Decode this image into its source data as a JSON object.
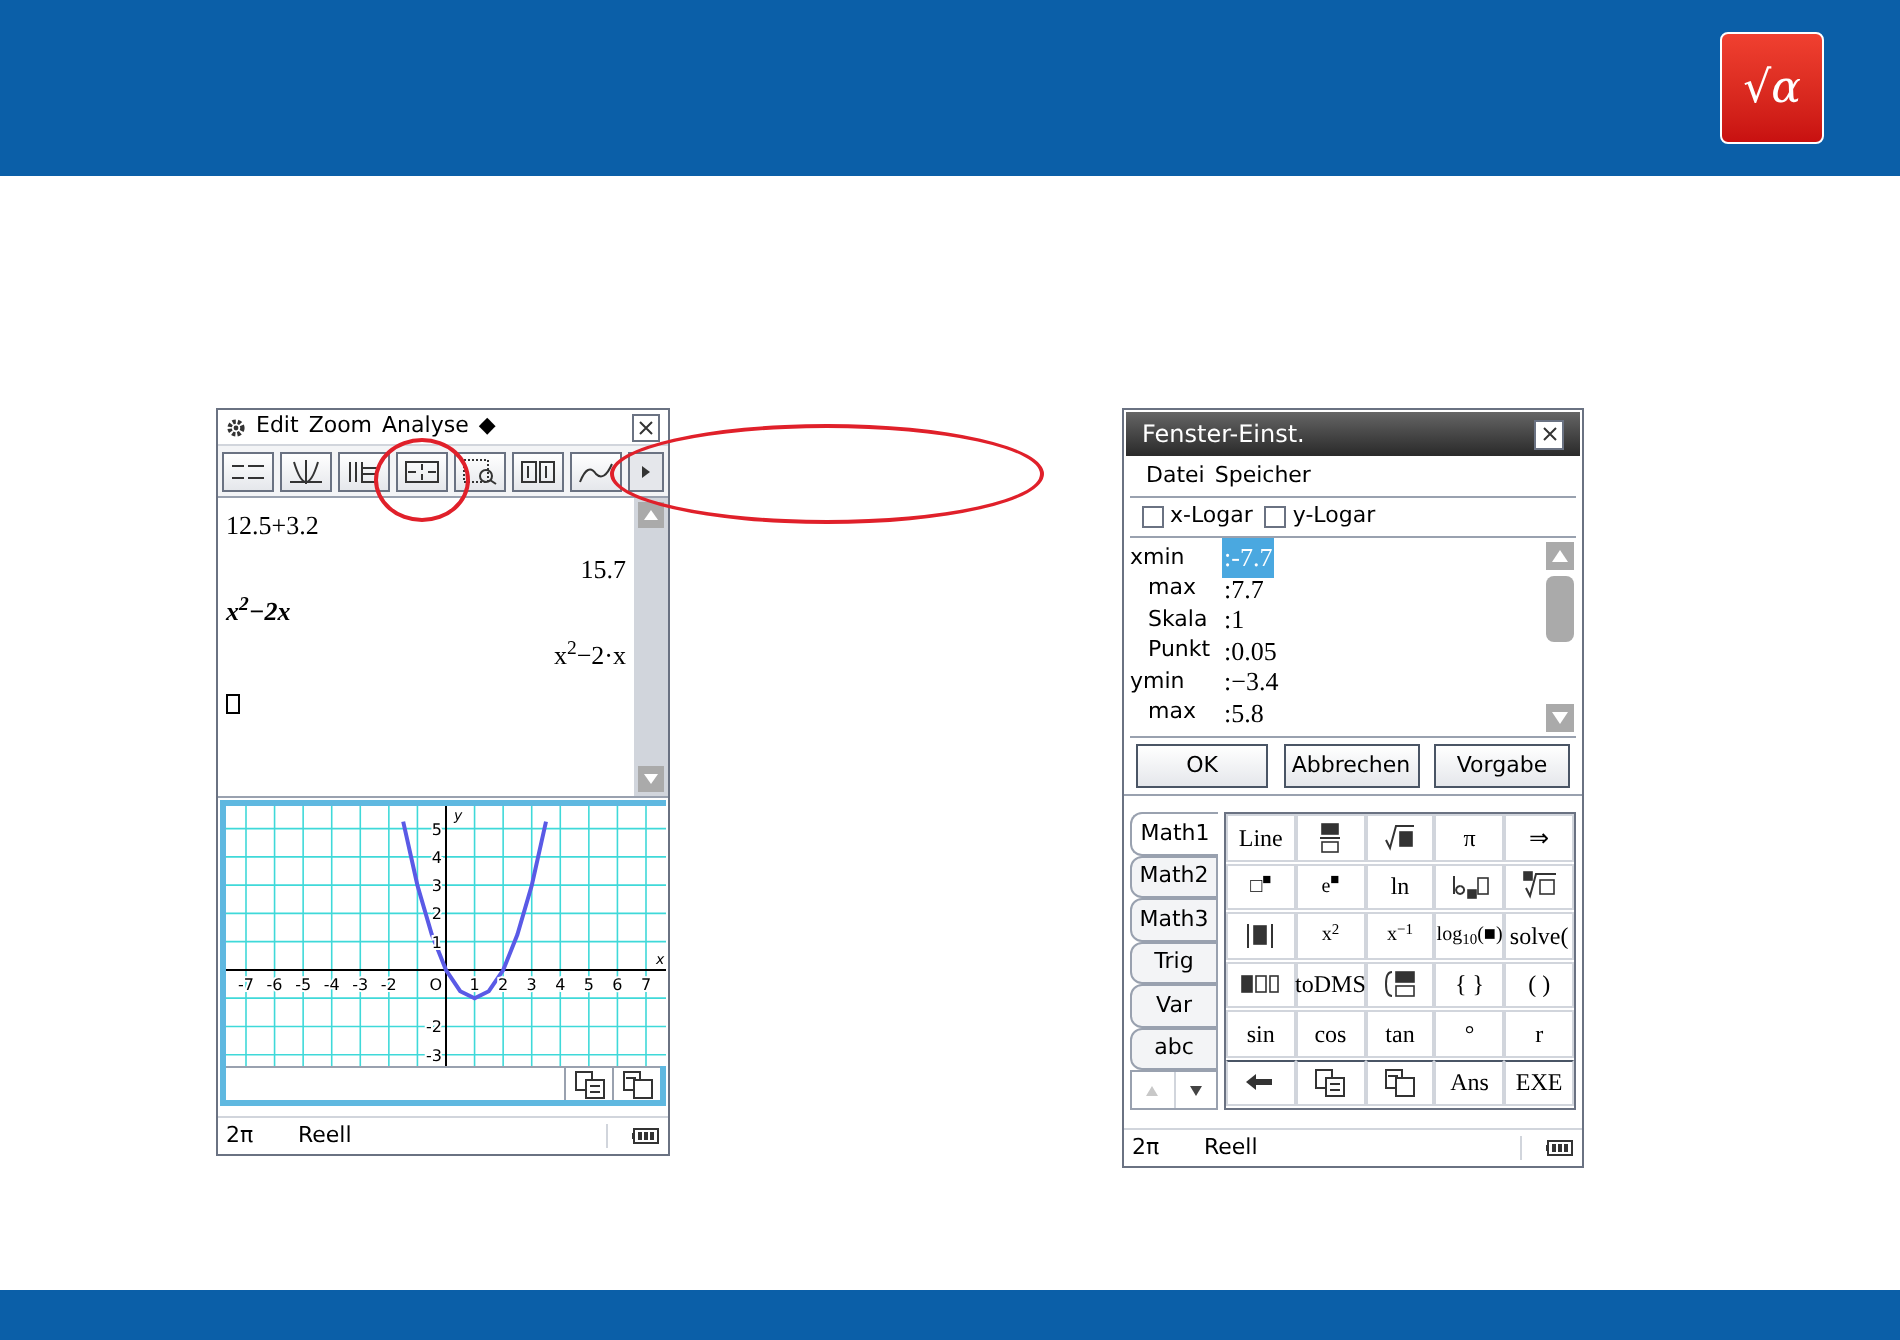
{
  "logo": {
    "label": "√α"
  },
  "left_calculator": {
    "menu": [
      "Edit",
      "Zoom",
      "Analyse",
      "◆"
    ],
    "entries": [
      {
        "input": "12.5+3.2",
        "output": "15.7",
        "italic": false
      },
      {
        "input": "x$^{2}$−2x",
        "output": "x$^{2}$−2·x",
        "italic": true
      }
    ],
    "graph": {
      "chart_data": {
        "type": "line",
        "x": [
          -1.5,
          -1,
          -0.5,
          0,
          0.5,
          1,
          1.5,
          2,
          2.5,
          3,
          3.5
        ],
        "series": [
          {
            "color": "#5a5ae6",
            "values": [
              5.25,
              3,
              1.25,
              0,
              -0.75,
              -1,
              -0.75,
              0,
              1.25,
              3,
              5.25
            ]
          }
        ],
        "xlim": [
          -7.7,
          7.7
        ],
        "ylim": [
          -3.4,
          5.8
        ],
        "xticks": [
          -7,
          -6,
          -5,
          -4,
          -3,
          -2,
          1,
          2,
          3,
          4,
          5,
          6,
          7
        ],
        "yticks": [
          -3,
          -2,
          1,
          2,
          3,
          4,
          5
        ],
        "xlabel": "x",
        "ylabel": "y",
        "grid": true
      },
      "origin_label": "O"
    },
    "status": {
      "angle": "2π",
      "format": "Reell"
    }
  },
  "right_calculator": {
    "title": "Fenster-Einst.",
    "menu": [
      "Datei",
      "Speicher"
    ],
    "checkboxes": [
      {
        "label": "x-Logar",
        "checked": false
      },
      {
        "label": "y-Logar",
        "checked": false
      }
    ],
    "settings": [
      {
        "label": "xmin",
        "value": ":-7.7",
        "kind": "head",
        "selected": true
      },
      {
        "label": "max",
        "value": ":7.7",
        "kind": "sub",
        "selected": false
      },
      {
        "label": "Skala",
        "value": ":1",
        "kind": "sub",
        "selected": false
      },
      {
        "label": "Punkt",
        "value": ":0.05",
        "kind": "sub",
        "selected": false
      },
      {
        "label": "ymin",
        "value": ":−3.4",
        "kind": "head",
        "selected": false
      },
      {
        "label": "max",
        "value": ":5.8",
        "kind": "sub",
        "selected": false
      }
    ],
    "buttons": [
      "OK",
      "Abbrechen",
      "Vorgabe"
    ],
    "tabs": [
      {
        "label": "Math1",
        "selected": true
      },
      {
        "label": "Math2",
        "selected": false
      },
      {
        "label": "Math3",
        "selected": false
      },
      {
        "label": "Trig",
        "selected": false
      },
      {
        "label": "Var",
        "selected": false
      },
      {
        "label": "abc",
        "selected": false
      }
    ],
    "keys": [
      {
        "kind": "text",
        "label": "Line"
      },
      {
        "kind": "icon"
      },
      {
        "kind": "icon"
      },
      {
        "kind": "text",
        "label": "π"
      },
      {
        "kind": "text",
        "label": "⇒"
      },
      {
        "kind": "text",
        "label": "□$^{■}$"
      },
      {
        "kind": "text",
        "label": "e$^{■}$"
      },
      {
        "kind": "text",
        "label": "ln"
      },
      {
        "kind": "icon"
      },
      {
        "kind": "icon"
      },
      {
        "kind": "icon"
      },
      {
        "kind": "text",
        "label": "x$^{2}$"
      },
      {
        "kind": "text",
        "label": "x$^{−1}$"
      },
      {
        "kind": "text",
        "label": "log$_{10}$(■)"
      },
      {
        "kind": "text",
        "label": "solve("
      },
      {
        "kind": "icon"
      },
      {
        "kind": "text",
        "label": "toDMS"
      },
      {
        "kind": "icon"
      },
      {
        "kind": "text",
        "label": "{ }"
      },
      {
        "kind": "text",
        "label": "( )"
      },
      {
        "kind": "text",
        "label": "sin"
      },
      {
        "kind": "text",
        "label": "cos"
      },
      {
        "kind": "text",
        "label": "tan"
      },
      {
        "kind": "text",
        "label": "°"
      },
      {
        "kind": "text",
        "label": "r"
      },
      {
        "kind": "icon"
      },
      {
        "kind": "icon"
      },
      {
        "kind": "icon"
      },
      {
        "kind": "text",
        "label": "Ans"
      },
      {
        "kind": "text",
        "label": "EXE"
      }
    ],
    "status": {
      "angle": "2π",
      "format": "Reell"
    }
  }
}
